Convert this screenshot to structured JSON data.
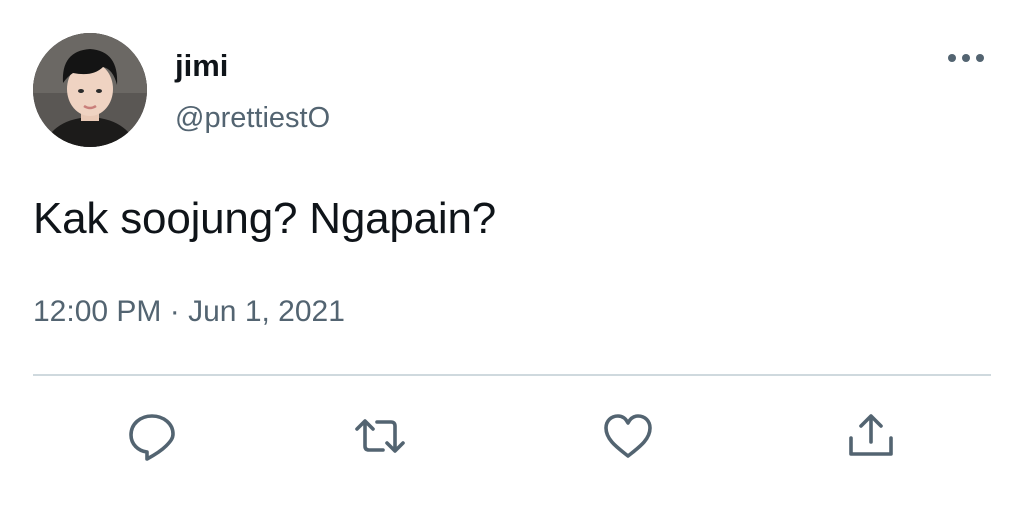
{
  "author": {
    "display_name": "jimi",
    "handle": "@prettiestO",
    "avatar_icon": "profile-photo"
  },
  "tweet": {
    "text": "Kak soojung? Ngapain?",
    "time": "12:00 PM",
    "separator": "·",
    "date": "Jun 1, 2021"
  },
  "actions": [
    {
      "name": "reply",
      "icon": "speech-bubble-icon"
    },
    {
      "name": "retweet",
      "icon": "retweet-arrows-icon"
    },
    {
      "name": "like",
      "icon": "heart-icon"
    },
    {
      "name": "share",
      "icon": "share-upload-icon"
    }
  ],
  "colors": {
    "primary_text": "#0f1419",
    "secondary_text": "#536471",
    "divider": "#cfd9de",
    "background": "#ffffff"
  }
}
